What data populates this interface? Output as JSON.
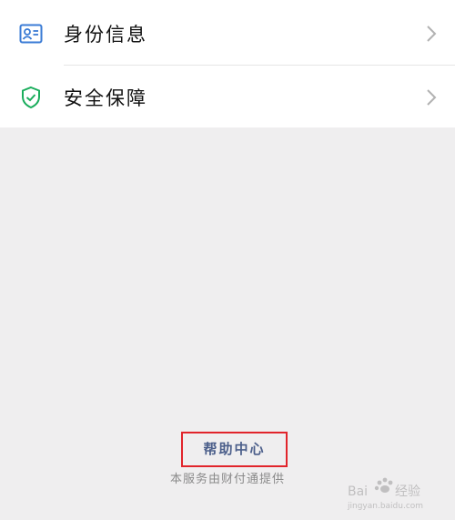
{
  "menu": {
    "items": [
      {
        "label": "身份信息",
        "icon": "id-card-icon"
      },
      {
        "label": "安全保障",
        "icon": "shield-check-icon"
      }
    ]
  },
  "footer": {
    "help_center": "帮助中心",
    "provider": "本服务由财付通提供"
  },
  "watermark": {
    "brand": "Baidu经验",
    "url": "jingyan.baidu.com"
  },
  "colors": {
    "background": "#efeeef",
    "id_icon": "#3a7bd5",
    "shield_icon": "#1aad5c",
    "link": "#4b5e8a",
    "highlight_border": "#e1242b"
  }
}
